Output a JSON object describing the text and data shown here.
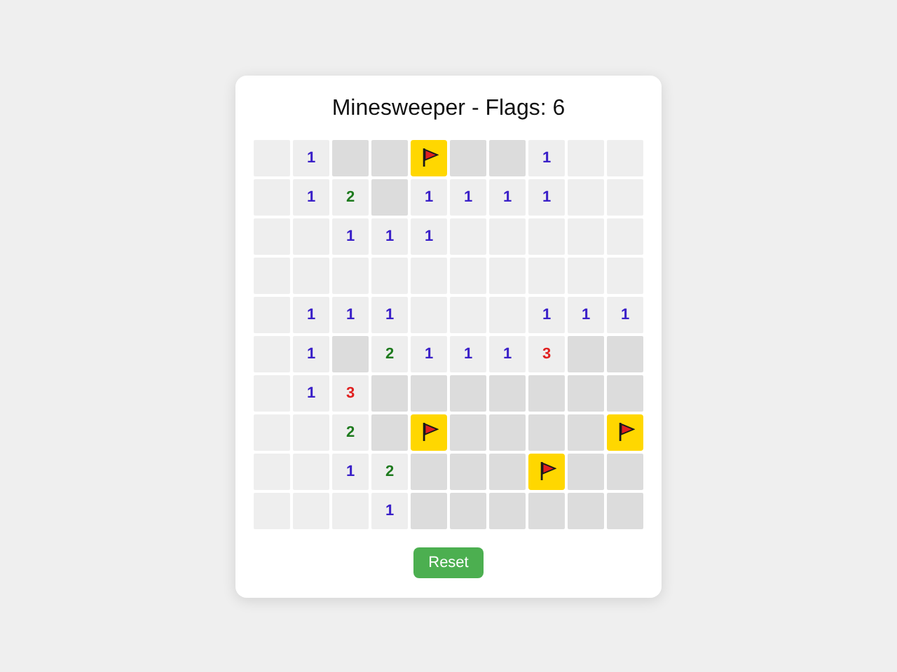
{
  "title": "Minesweeper - Flags: 6",
  "rows": [
    [
      {
        "kind": "open"
      },
      {
        "kind": "open",
        "text": "1",
        "color": "#3a20c8"
      },
      {
        "kind": "hidden"
      },
      {
        "kind": "hidden"
      },
      {
        "kind": "flag"
      },
      {
        "kind": "hidden"
      },
      {
        "kind": "hidden"
      },
      {
        "kind": "open",
        "text": "1",
        "color": "#3a20c8"
      },
      {
        "kind": "open"
      },
      {
        "kind": "open"
      }
    ],
    [
      {
        "kind": "open"
      },
      {
        "kind": "open",
        "text": "1",
        "color": "#3a20c8"
      },
      {
        "kind": "open",
        "text": "2",
        "color": "#1e7a1e"
      },
      {
        "kind": "hidden"
      },
      {
        "kind": "open",
        "text": "1",
        "color": "#3a20c8"
      },
      {
        "kind": "open",
        "text": "1",
        "color": "#3a20c8"
      },
      {
        "kind": "open",
        "text": "1",
        "color": "#3a20c8"
      },
      {
        "kind": "open",
        "text": "1",
        "color": "#3a20c8"
      },
      {
        "kind": "open"
      },
      {
        "kind": "open"
      }
    ],
    [
      {
        "kind": "open"
      },
      {
        "kind": "open"
      },
      {
        "kind": "open",
        "text": "1",
        "color": "#3a20c8"
      },
      {
        "kind": "open",
        "text": "1",
        "color": "#3a20c8"
      },
      {
        "kind": "open",
        "text": "1",
        "color": "#3a20c8"
      },
      {
        "kind": "open"
      },
      {
        "kind": "open"
      },
      {
        "kind": "open"
      },
      {
        "kind": "open"
      },
      {
        "kind": "open"
      }
    ],
    [
      {
        "kind": "open"
      },
      {
        "kind": "open"
      },
      {
        "kind": "open"
      },
      {
        "kind": "open"
      },
      {
        "kind": "open"
      },
      {
        "kind": "open"
      },
      {
        "kind": "open"
      },
      {
        "kind": "open"
      },
      {
        "kind": "open"
      },
      {
        "kind": "open"
      }
    ],
    [
      {
        "kind": "open"
      },
      {
        "kind": "open",
        "text": "1",
        "color": "#3a20c8"
      },
      {
        "kind": "open",
        "text": "1",
        "color": "#3a20c8"
      },
      {
        "kind": "open",
        "text": "1",
        "color": "#3a20c8"
      },
      {
        "kind": "open"
      },
      {
        "kind": "open"
      },
      {
        "kind": "open"
      },
      {
        "kind": "open",
        "text": "1",
        "color": "#3a20c8"
      },
      {
        "kind": "open",
        "text": "1",
        "color": "#3a20c8"
      },
      {
        "kind": "open",
        "text": "1",
        "color": "#3a20c8"
      }
    ],
    [
      {
        "kind": "open"
      },
      {
        "kind": "open",
        "text": "1",
        "color": "#3a20c8"
      },
      {
        "kind": "hidden"
      },
      {
        "kind": "open",
        "text": "2",
        "color": "#1e7a1e"
      },
      {
        "kind": "open",
        "text": "1",
        "color": "#3a20c8"
      },
      {
        "kind": "open",
        "text": "1",
        "color": "#3a20c8"
      },
      {
        "kind": "open",
        "text": "1",
        "color": "#3a20c8"
      },
      {
        "kind": "open",
        "text": "3",
        "color": "#e02020"
      },
      {
        "kind": "hidden"
      },
      {
        "kind": "hidden"
      }
    ],
    [
      {
        "kind": "open"
      },
      {
        "kind": "open",
        "text": "1",
        "color": "#3a20c8"
      },
      {
        "kind": "open",
        "text": "3",
        "color": "#e02020"
      },
      {
        "kind": "hidden"
      },
      {
        "kind": "hidden"
      },
      {
        "kind": "hidden"
      },
      {
        "kind": "hidden"
      },
      {
        "kind": "hidden"
      },
      {
        "kind": "hidden"
      },
      {
        "kind": "hidden"
      }
    ],
    [
      {
        "kind": "open"
      },
      {
        "kind": "open"
      },
      {
        "kind": "open",
        "text": "2",
        "color": "#1e7a1e"
      },
      {
        "kind": "hidden"
      },
      {
        "kind": "flag"
      },
      {
        "kind": "hidden"
      },
      {
        "kind": "hidden"
      },
      {
        "kind": "hidden"
      },
      {
        "kind": "hidden"
      },
      {
        "kind": "flag"
      }
    ],
    [
      {
        "kind": "open"
      },
      {
        "kind": "open"
      },
      {
        "kind": "open",
        "text": "1",
        "color": "#3a20c8"
      },
      {
        "kind": "open",
        "text": "2",
        "color": "#1e7a1e"
      },
      {
        "kind": "hidden"
      },
      {
        "kind": "hidden"
      },
      {
        "kind": "hidden"
      },
      {
        "kind": "flag"
      },
      {
        "kind": "hidden"
      },
      {
        "kind": "hidden"
      }
    ],
    [
      {
        "kind": "open"
      },
      {
        "kind": "open"
      },
      {
        "kind": "open"
      },
      {
        "kind": "open",
        "text": "1",
        "color": "#3a20c8"
      },
      {
        "kind": "hidden"
      },
      {
        "kind": "hidden"
      },
      {
        "kind": "hidden"
      },
      {
        "kind": "hidden"
      },
      {
        "kind": "hidden"
      },
      {
        "kind": "hidden"
      }
    ]
  ],
  "reset_button": "Reset"
}
